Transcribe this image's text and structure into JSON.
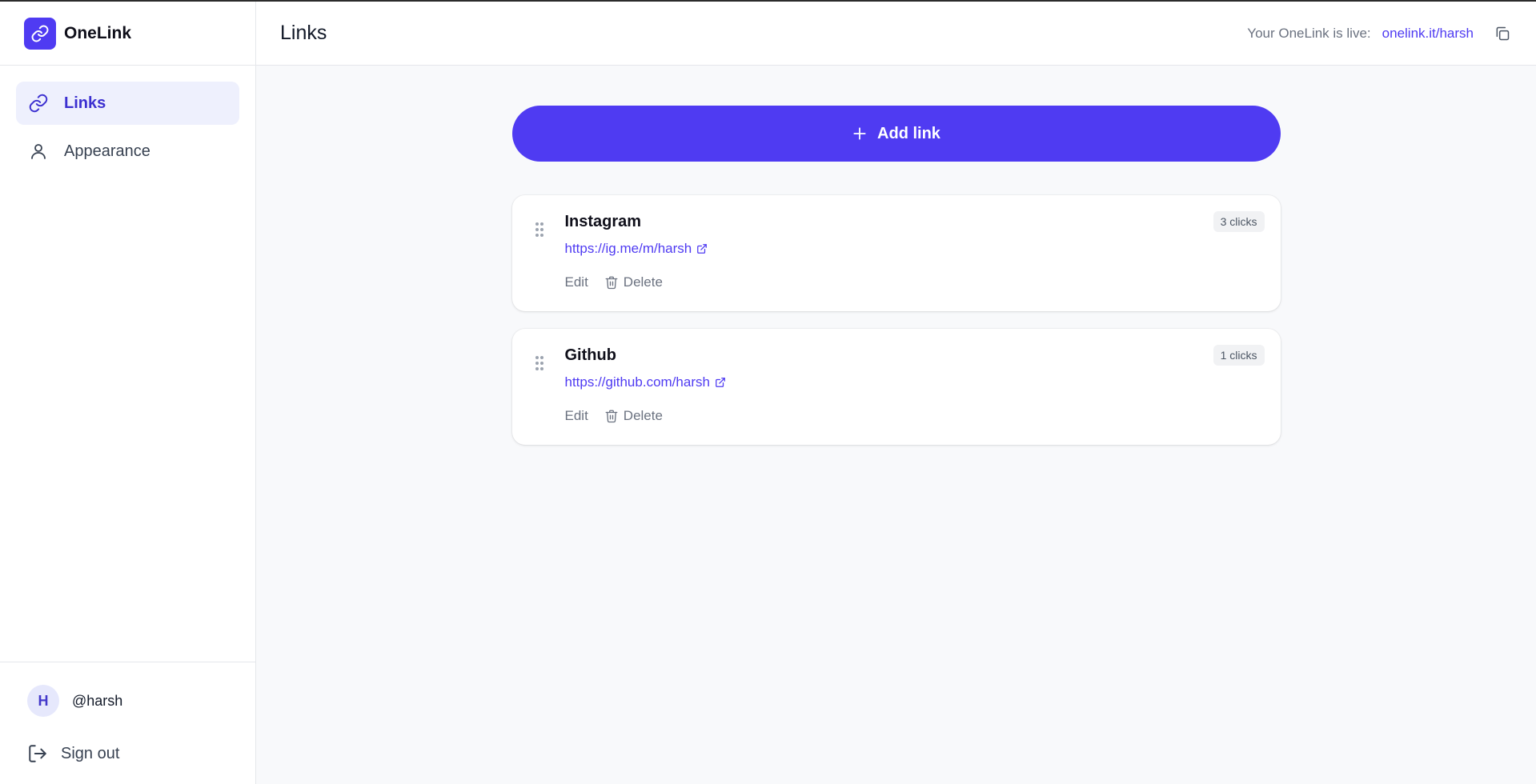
{
  "brand": {
    "name": "OneLink",
    "icon": "link-icon",
    "accent": "#4f3bf2"
  },
  "sidebar": {
    "items": [
      {
        "label": "Links",
        "icon": "link-icon",
        "active": true
      },
      {
        "label": "Appearance",
        "icon": "user-icon",
        "active": false
      }
    ],
    "user": {
      "initial": "H",
      "handle": "@harsh"
    },
    "signout_label": "Sign out"
  },
  "header": {
    "title": "Links",
    "live_text": "Your OneLink is live:",
    "live_link": "onelink.it/harsh",
    "copy_icon": "copy-icon"
  },
  "main": {
    "add_label": "Add link",
    "links": [
      {
        "title": "Instagram",
        "url": "https://ig.me/m/harsh",
        "clicks": "3 clicks",
        "edit": "Edit",
        "delete": "Delete"
      },
      {
        "title": "Github",
        "url": "https://github.com/harsh",
        "clicks": "1 clicks",
        "edit": "Edit",
        "delete": "Delete"
      }
    ]
  }
}
